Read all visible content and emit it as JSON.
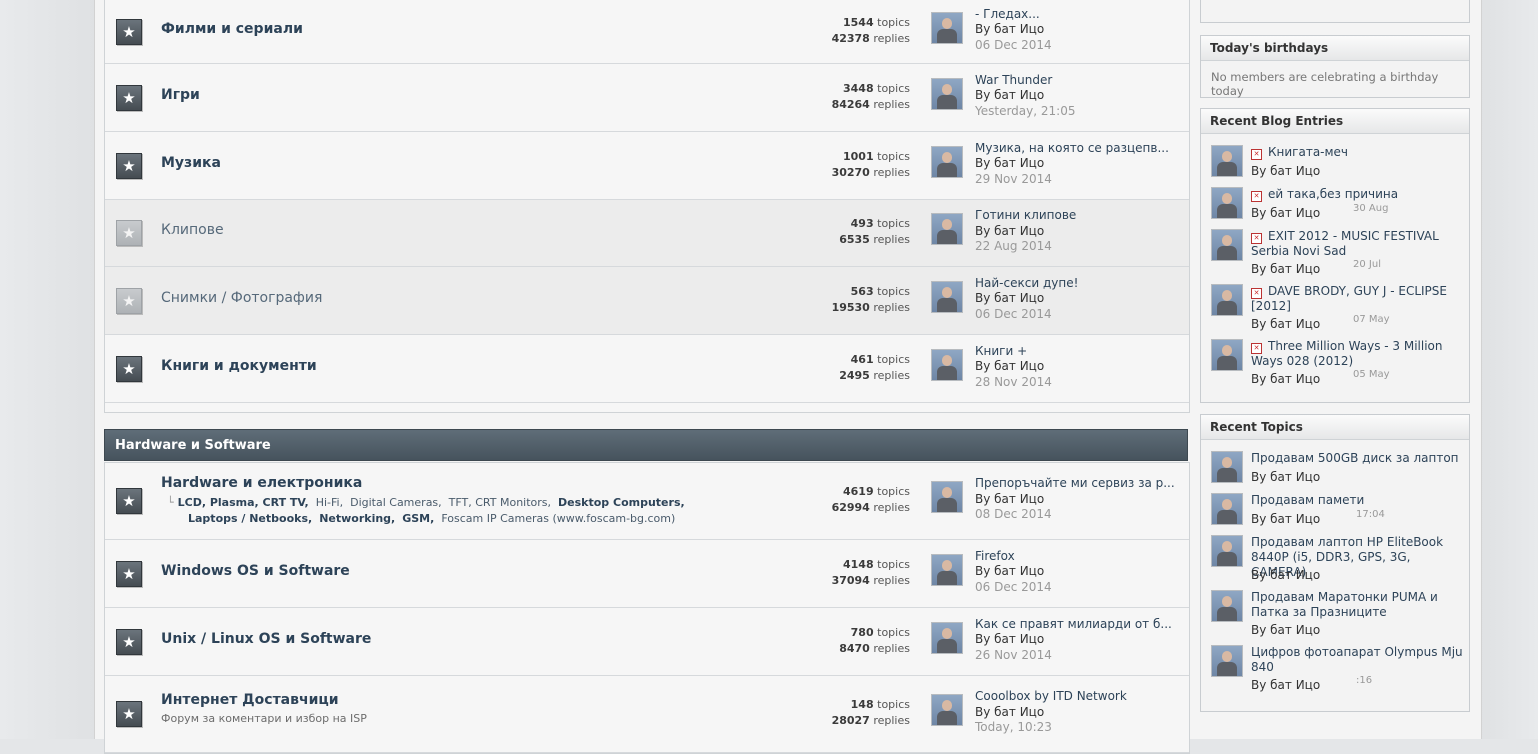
{
  "forums_top": [
    {
      "name": "Филми и сериали",
      "topics": "1544",
      "replies": "42378",
      "last_title": "- Гледах...",
      "last_by": "By бат Ицо",
      "last_date": "06 Dec 2014",
      "read": false
    },
    {
      "name": "Игри",
      "topics": "3448",
      "replies": "84264",
      "last_title": "War Thunder",
      "last_by": "By бат Ицо",
      "last_date": "Yesterday, 21:05",
      "read": false
    },
    {
      "name": "Музика",
      "topics": "1001",
      "replies": "30270",
      "last_title": "Музика, на която се разцепв...",
      "last_by": "By бат Ицо",
      "last_date": "29 Nov 2014",
      "read": false
    },
    {
      "name": "Клипове",
      "topics": "493",
      "replies": "6535",
      "last_title": "Готини клипове",
      "last_by": "By бат Ицо",
      "last_date": "22 Aug 2014",
      "read": true
    },
    {
      "name": "Снимки / Фотография",
      "topics": "563",
      "replies": "19530",
      "last_title": "Най-секси дупе!",
      "last_by": "By бат Ицо",
      "last_date": "06 Dec 2014",
      "read": true
    },
    {
      "name": "Книги и документи",
      "topics": "461",
      "replies": "2495",
      "last_title": "Книги +",
      "last_by": "By бат Ицо",
      "last_date": "28 Nov 2014",
      "read": false
    }
  ],
  "labels": {
    "topics": "topics",
    "replies": "replies"
  },
  "category": {
    "title": "Hardware и Software"
  },
  "forums_hw": [
    {
      "name": "Hardware и електроника",
      "topics": "4619",
      "replies": "62994",
      "last_title": "Препоръчайте ми сервиз за р...",
      "last_by": "By бат Ицо",
      "last_date": "08 Dec 2014",
      "subforums_line1": [
        "LCD, Plasma, CRT TV,",
        "Hi-Fi,",
        "Digital Cameras,",
        "TFT, CRT Monitors,",
        "Desktop Computers,"
      ],
      "subforums_line2": [
        "Laptops / Netbooks,",
        "Networking,",
        "GSM,",
        "Foscam IP Cameras (www.foscam-bg.com)"
      ]
    },
    {
      "name": "Windows OS и Software",
      "topics": "4148",
      "replies": "37094",
      "last_title": "Firefox",
      "last_by": "By бат Ицо",
      "last_date": "06 Dec 2014"
    },
    {
      "name": "Unix / Linux OS и Software",
      "topics": "780",
      "replies": "8470",
      "last_title": "Как се правят милиарди от б...",
      "last_by": "By бат Ицо",
      "last_date": "26 Nov 2014"
    },
    {
      "name": "Интернет Доставчици",
      "desc": "Форум за коментари и избор на ISP",
      "topics": "148",
      "replies": "28027",
      "last_title": "Cooolbox by ITD Network",
      "last_by": "By бат Ицо",
      "last_date": "Today, 10:23"
    }
  ],
  "sidebar": {
    "birthdays": {
      "title": "Today's birthdays",
      "text": "No members are celebrating a birthday today"
    },
    "blog": {
      "title": "Recent Blog Entries",
      "entries": [
        {
          "title": "Книгата-меч",
          "by": "By бат Ицо",
          "date": ""
        },
        {
          "title": "ей така,без причина",
          "by": "By бат Ицо",
          "date": "30 Aug"
        },
        {
          "title": "EXIT 2012 - MUSIC FESTIVAL Serbia Novi Sad",
          "by": "By бат Ицо",
          "date": "20 Jul"
        },
        {
          "title": "DAVE BRODY, GUY J - ECLIPSE [2012]",
          "by": "By бат Ицо",
          "date": "07 May"
        },
        {
          "title": "Three Million Ways - 3 Million Ways 028 (2012)",
          "by": "By бат Ицо",
          "date": "05 May"
        }
      ]
    },
    "topics": {
      "title": "Recent Topics",
      "entries": [
        {
          "title": "Продавам 500GB диск за лаптоп",
          "by": "By бат Ицо",
          "date": ""
        },
        {
          "title": "Продавам памети",
          "by": "By бат Ицо",
          "date": "17:04"
        },
        {
          "title": "Продавам лаптоп HP EliteBook 8440P (i5, DDR3, GPS, 3G, CAMERA)",
          "by": "By бат Ицо",
          "date": ""
        },
        {
          "title": "Продавам Маратонки PUMA и Патка за Празниците",
          "by": "By бат Ицо",
          "date": ""
        },
        {
          "title": "Цифров фотоапарат Olympus Mju 840",
          "by": "By бат Ицо",
          "date": ":16"
        }
      ]
    }
  }
}
